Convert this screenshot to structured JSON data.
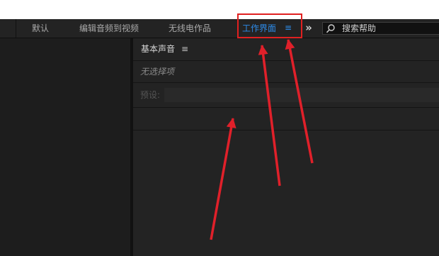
{
  "workspace_bar": {
    "tabs": [
      {
        "label": "默认"
      },
      {
        "label": "编辑音频到视频"
      },
      {
        "label": "无线电作品"
      },
      {
        "label": "工作界面"
      }
    ],
    "active_tab": "工作界面",
    "active_menu_glyph": "≡",
    "overflow_glyph": "»",
    "search": {
      "text": "搜索帮助",
      "icon": "search-icon"
    },
    "accent_color": "#2d8ceb"
  },
  "essential_sound_panel": {
    "title": "基本声音",
    "menu_glyph": "≡",
    "no_selection_text": "无选择项",
    "preset_label": "预设:"
  },
  "annotations": {
    "highlight_color": "#e02020",
    "arrow_color": "#e0202a",
    "arrow_count": 3
  }
}
